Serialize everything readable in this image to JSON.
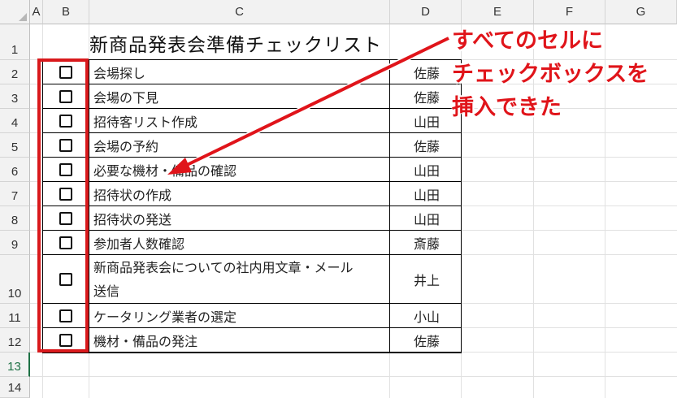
{
  "columns": [
    "A",
    "B",
    "C",
    "D",
    "E",
    "F",
    "G"
  ],
  "rows": [
    "1",
    "2",
    "3",
    "4",
    "5",
    "6",
    "7",
    "8",
    "9",
    "10",
    "11",
    "12",
    "13",
    "14"
  ],
  "title": "新商品発表会準備チェックリスト",
  "items": [
    {
      "task": "会場探し",
      "person": "佐藤",
      "checked": false
    },
    {
      "task": "会場の下見",
      "person": "佐藤",
      "checked": false
    },
    {
      "task": "招待客リスト作成",
      "person": "山田",
      "checked": false
    },
    {
      "task": "会場の予約",
      "person": "佐藤",
      "checked": false
    },
    {
      "task": "必要な機材・備品の確認",
      "person": "山田",
      "checked": false
    },
    {
      "task": "招待状の作成",
      "person": "山田",
      "checked": false
    },
    {
      "task": "招待状の発送",
      "person": "山田",
      "checked": false
    },
    {
      "task": "参加者人数確認",
      "person": "斎藤",
      "checked": false
    },
    {
      "task_line1": "新商品発表会についての社内用文章・メール",
      "task_line2": "送信",
      "person": "井上",
      "checked": false
    },
    {
      "task": "ケータリング業者の選定",
      "person": "小山",
      "checked": false
    },
    {
      "task": "機材・備品の発注",
      "person": "佐藤",
      "checked": false
    }
  ],
  "annotation": {
    "line1": "すべてのセルに",
    "line2": "チェックボックスを",
    "line3": "挿入できた",
    "color": "#e0141a"
  },
  "selected_row": "13"
}
